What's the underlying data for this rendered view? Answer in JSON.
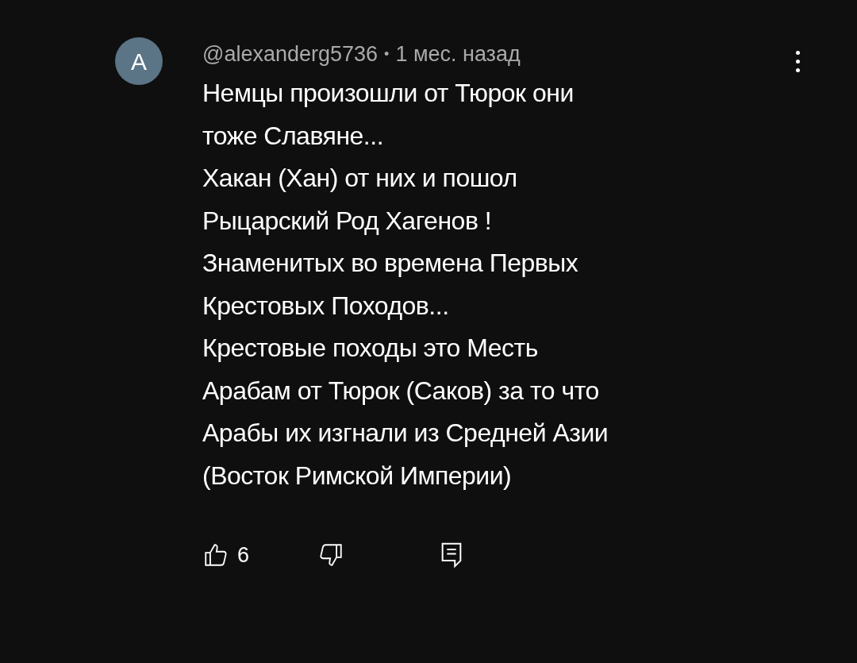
{
  "comment": {
    "avatar_letter": "A",
    "author": "@alexanderg5736",
    "separator": "•",
    "time": "1 мес. назад",
    "lines": [
      "Немцы произошли от Тюрок они",
      "тоже Славяне...",
      "Хакан (Хан) от них и пошол",
      "Рыцарский Род Хагенов !",
      "Знаменитых во времена Первых",
      "Крестовых Походов...",
      "Крестовые походы это Месть",
      "Арабам от Тюрок (Саков) за то что",
      "Арабы их изгнали из Средней Азии",
      "(Восток Римской Империи)"
    ],
    "likes": "6"
  }
}
